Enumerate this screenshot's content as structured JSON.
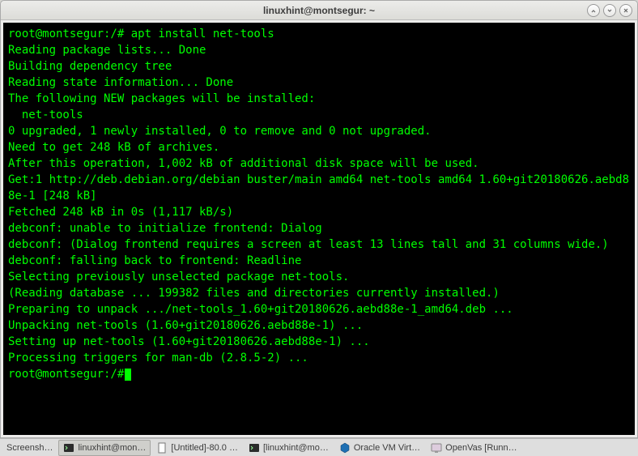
{
  "window": {
    "title": "linuxhint@montsegur: ~"
  },
  "terminal": {
    "prompt1": "root@montsegur:/# ",
    "command1": "apt install net-tools",
    "lines": [
      "Reading package lists... Done",
      "Building dependency tree",
      "Reading state information... Done",
      "The following NEW packages will be installed:",
      "  net-tools",
      "0 upgraded, 1 newly installed, 0 to remove and 0 not upgraded.",
      "Need to get 248 kB of archives.",
      "After this operation, 1,002 kB of additional disk space will be used.",
      "Get:1 http://deb.debian.org/debian buster/main amd64 net-tools amd64 1.60+git20180626.aebd88e-1 [248 kB]",
      "Fetched 248 kB in 0s (1,117 kB/s)",
      "debconf: unable to initialize frontend: Dialog",
      "debconf: (Dialog frontend requires a screen at least 13 lines tall and 31 columns wide.)",
      "debconf: falling back to frontend: Readline",
      "Selecting previously unselected package net-tools.",
      "(Reading database ... 199382 files and directories currently installed.)",
      "Preparing to unpack .../net-tools_1.60+git20180626.aebd88e-1_amd64.deb ...",
      "Unpacking net-tools (1.60+git20180626.aebd88e-1) ...",
      "Setting up net-tools (1.60+git20180626.aebd88e-1) ...",
      "Processing triggers for man-db (2.8.5-2) ..."
    ],
    "prompt2": "root@montsegur:/#"
  },
  "taskbar": {
    "items": [
      {
        "label": "Screensh…"
      },
      {
        "label": "linuxhint@mon…"
      },
      {
        "label": "[Untitled]-80.0 …"
      },
      {
        "label": "[linuxhint@mo…"
      },
      {
        "label": "Oracle VM Virt…"
      },
      {
        "label": "OpenVas [Runn…"
      }
    ]
  }
}
